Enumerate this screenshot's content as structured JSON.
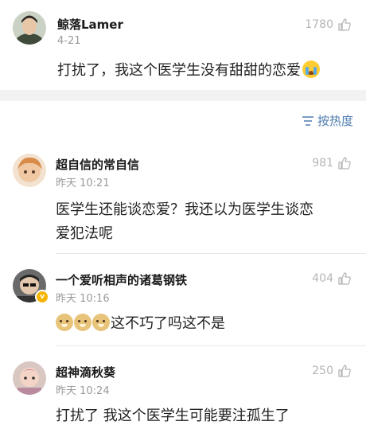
{
  "post": {
    "user": "鲸落Lamer",
    "time": "4-21",
    "likes": "1780",
    "text": "打扰了，我这个医学生没有甜甜的恋爱",
    "emoji": "crying-emoji"
  },
  "sort": {
    "label": "按热度",
    "icon": "sort-icon"
  },
  "comments": [
    {
      "user": "超自信的常自信",
      "time": "昨天 10:21",
      "likes": "981",
      "text_line1": "医学生还能谈恋爱？我还以为医学生谈恋",
      "text_line2": "爱犯法呢"
    },
    {
      "user": "一个爱听相声的诸葛钢铁",
      "time": "昨天 10:16",
      "likes": "404",
      "text": "这不巧了吗这不是",
      "emoji": "doge-emoji",
      "badge": "v"
    },
    {
      "user": "超神滴秋葵",
      "time": "昨天 10:24",
      "likes": "250",
      "text": "打扰了 我这个医学生可能要注孤生了"
    }
  ],
  "colors": {
    "accent": "#507daf",
    "muted": "#9a9a9a",
    "gap": "#f2f2f2"
  }
}
